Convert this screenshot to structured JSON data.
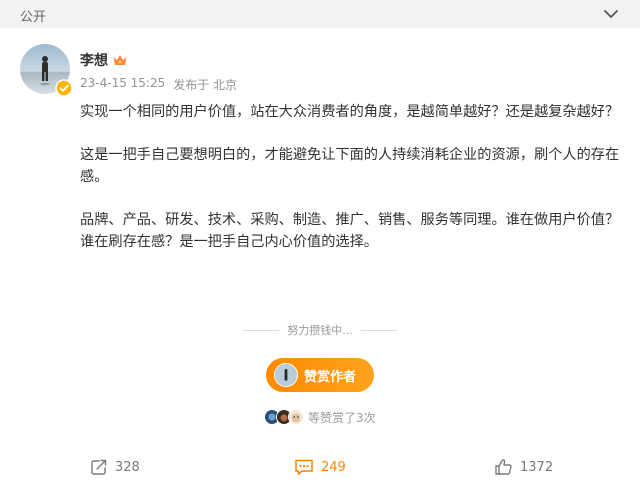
{
  "header": {
    "visibility": "公开",
    "collapse_icon": "chevron-down-icon"
  },
  "author": {
    "name": "李想",
    "badge_icon": "crown-icon",
    "verified_icon": "verified-icon"
  },
  "meta": {
    "time": "23-4-15 15:25",
    "source": "发布于 北京"
  },
  "post": {
    "paragraphs": [
      "实现一个相同的用户价值，站在大众消费者的角度，是越简单越好？还是越复杂越好？",
      "这是一把手自己要想明白的，才能避免让下面的人持续消耗企业的资源，刷个人的存在感。",
      "品牌、产品、研发、技术、采购、制造、推广、销售、服务等同理。谁在做用户价值？谁在刷存在感？是一把手自己内心价值的选择。"
    ]
  },
  "reward": {
    "tip": "努力攒钱中...",
    "button_label": "赞赏作者",
    "rewarded_text": "等赞赏了3次"
  },
  "actions": {
    "repost_count": "328",
    "comment_count": "249",
    "like_count": "1372"
  },
  "colors": {
    "accent": "#ff8200",
    "muted": "#939393",
    "topbar": "#f2f2f2"
  }
}
